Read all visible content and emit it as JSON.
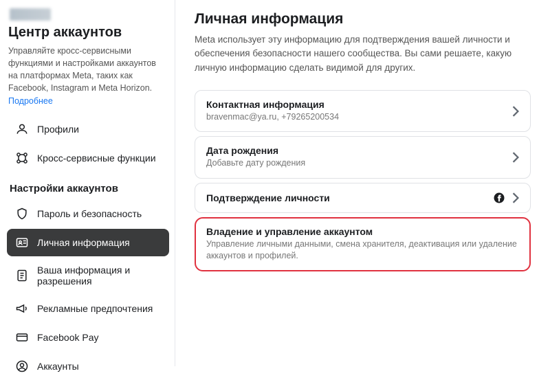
{
  "sidebar": {
    "title": "Центр аккаунтов",
    "description_prefix": "Управляйте кросс-сервисными функциями и настройками аккаунтов на платформах Meta, таких как Facebook, Instagram и Meta Horizon. ",
    "learn_more": "Подробнее",
    "section_title": "Настройки аккаунтов",
    "items_top": [
      {
        "label": "Профили",
        "icon": "profile-icon"
      },
      {
        "label": "Кросс-сервисные функции",
        "icon": "cross-icon"
      }
    ],
    "items_bottom": [
      {
        "label": "Пароль и безопасность",
        "icon": "shield-icon"
      },
      {
        "label": "Личная информация",
        "icon": "id-icon",
        "active": true
      },
      {
        "label": "Ваша информация и разрешения",
        "icon": "doc-icon"
      },
      {
        "label": "Рекламные предпочтения",
        "icon": "megaphone-icon"
      },
      {
        "label": "Facebook Pay",
        "icon": "card-icon"
      },
      {
        "label": "Аккаунты",
        "icon": "account-icon"
      }
    ]
  },
  "main": {
    "title": "Личная информация",
    "description": "Meta использует эту информацию для подтверждения вашей личности и обеспечения безопасности нашего сообщества. Вы сами решаете, какую личную информацию сделать видимой для других.",
    "cards": [
      {
        "title": "Контактная информация",
        "sub": "bravenmac@ya.ru, +79265200534"
      },
      {
        "title": "Дата рождения",
        "sub": "Добавьте дату рождения"
      },
      {
        "title": "Подтверждение личности",
        "sub": "",
        "fb_icon": true
      },
      {
        "title": "Владение и управление аккаунтом",
        "sub": "Управление личными данными, смена хранителя, деактивация или удаление аккаунтов и профилей.",
        "highlighted": true
      }
    ]
  }
}
